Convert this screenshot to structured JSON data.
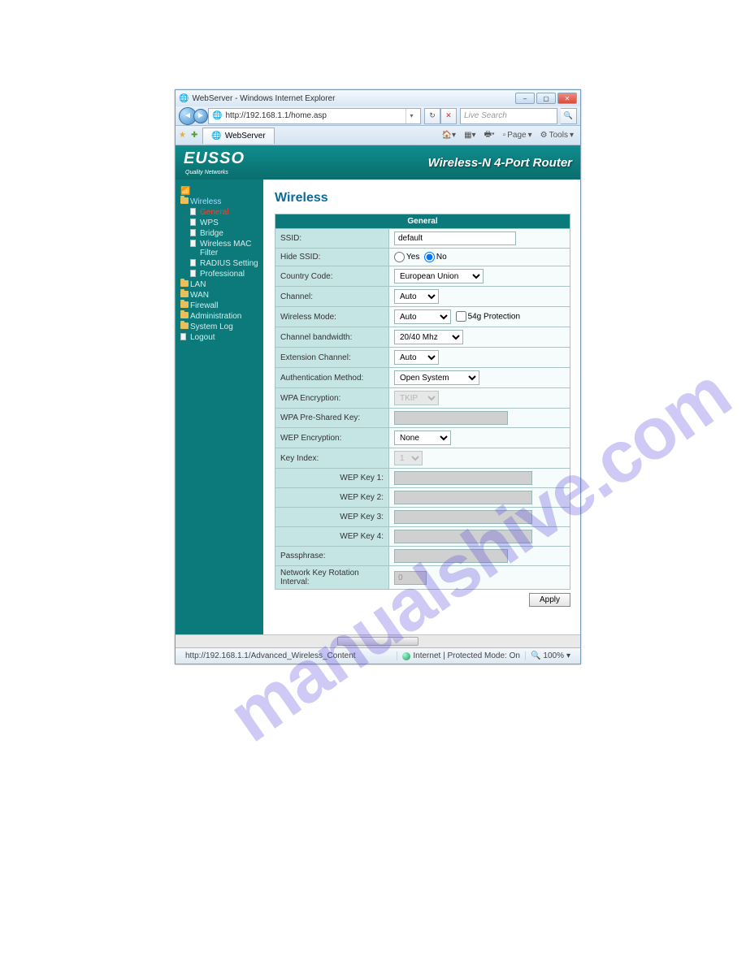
{
  "window": {
    "title": "WebServer - Windows Internet Explorer"
  },
  "nav": {
    "url": "http://192.168.1.1/home.asp",
    "search_placeholder": "Live Search"
  },
  "tabs": {
    "active": "WebServer"
  },
  "toolbar": {
    "page": "Page",
    "tools": "Tools"
  },
  "brand": {
    "logo": "EUSSO",
    "tag": "Quality Networks",
    "product": "Wireless-N 4-Port Router"
  },
  "sidebar": {
    "wireless": "Wireless",
    "items": [
      {
        "label": "General"
      },
      {
        "label": "WPS"
      },
      {
        "label": "Bridge"
      },
      {
        "label": "Wireless MAC Filter"
      },
      {
        "label": "RADIUS Setting"
      },
      {
        "label": "Professional"
      }
    ],
    "folders": [
      {
        "label": "LAN"
      },
      {
        "label": "WAN"
      },
      {
        "label": "Firewall"
      },
      {
        "label": "Administration"
      },
      {
        "label": "System Log"
      }
    ],
    "logout": "Logout"
  },
  "panel": {
    "title": "Wireless",
    "section": "General",
    "rows": {
      "ssid_lbl": "SSID:",
      "ssid_val": "default",
      "hide_lbl": "Hide SSID:",
      "hide_yes": "Yes",
      "hide_no": "No",
      "country_lbl": "Country Code:",
      "country_val": "European Union",
      "channel_lbl": "Channel:",
      "channel_val": "Auto",
      "mode_lbl": "Wireless Mode:",
      "mode_val": "Auto",
      "mode_chk": "54g Protection",
      "bw_lbl": "Channel bandwidth:",
      "bw_val": "20/40 Mhz",
      "ext_lbl": "Extension Channel:",
      "ext_val": "Auto",
      "auth_lbl": "Authentication Method:",
      "auth_val": "Open System",
      "wpae_lbl": "WPA Encryption:",
      "wpae_val": "TKIP",
      "psk_lbl": "WPA Pre-Shared Key:",
      "wepe_lbl": "WEP Encryption:",
      "wepe_val": "None",
      "kidx_lbl": "Key Index:",
      "kidx_val": "1",
      "wep1": "WEP Key 1:",
      "wep2": "WEP Key 2:",
      "wep3": "WEP Key 3:",
      "wep4": "WEP Key 4:",
      "pass_lbl": "Passphrase:",
      "rot_lbl": "Network Key Rotation Interval:",
      "rot_val": "0"
    },
    "apply": "Apply"
  },
  "status": {
    "left": "http://192.168.1.1/Advanced_Wireless_Content",
    "zone": "Internet | Protected Mode: On",
    "zoom": "100%"
  },
  "watermark": "manualshive.com"
}
